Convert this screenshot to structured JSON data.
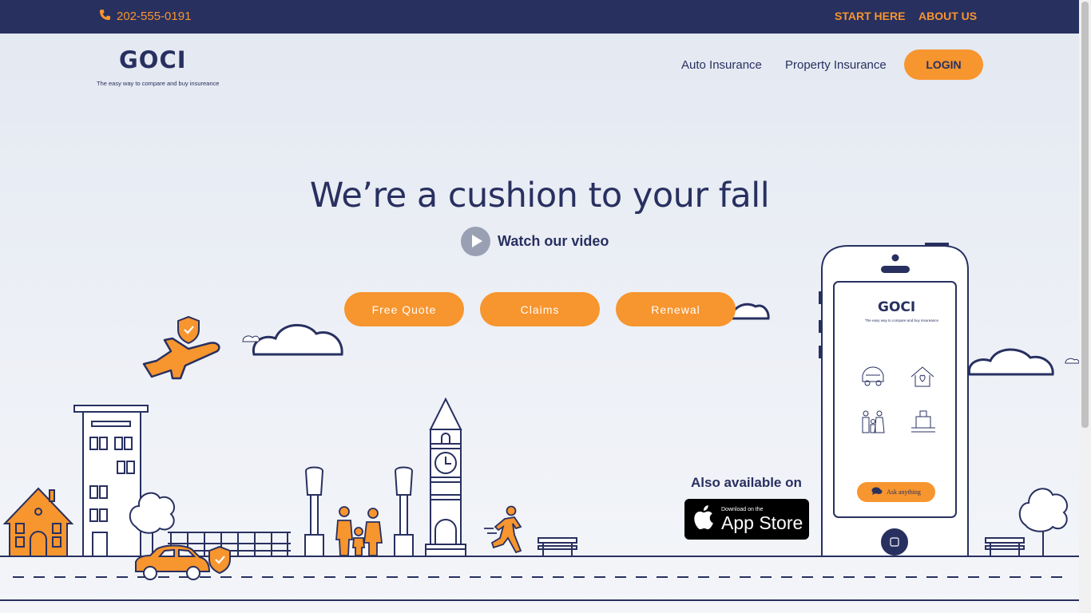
{
  "topbar": {
    "phone": "202-555-0191",
    "links": [
      "START HERE",
      "ABOUT US"
    ]
  },
  "header": {
    "logo": "GOCI",
    "tagline": "The easy way to compare and buy insureance",
    "nav": [
      "Auto Insurance",
      "Property Insurance"
    ],
    "login": "LOGIN"
  },
  "hero": {
    "headline": "We’re a cushion to your fall",
    "video": "Watch our video",
    "buttons": [
      "Free Quote",
      "Claims",
      "Renewal"
    ],
    "available": "Also available on",
    "appstore_small": "Download on the",
    "appstore_large": "App Store"
  },
  "phone_mockup": {
    "logo": "GOCI",
    "tagline": "The easy way to compare and buy insureance",
    "ask": "Ask anything"
  },
  "colors": {
    "navy": "#283060",
    "orange": "#f7952e",
    "background": "#e8ecf3"
  },
  "icons": [
    "phone-icon",
    "play-icon",
    "apple-icon",
    "chat-icon",
    "car-icon",
    "home-heart-icon",
    "family-icon",
    "luggage-icon"
  ]
}
